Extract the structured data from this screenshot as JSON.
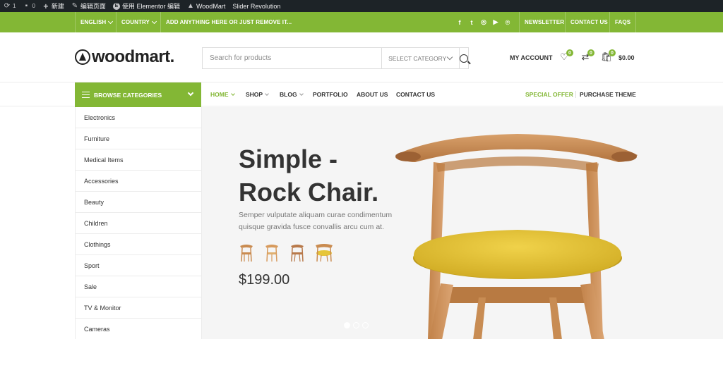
{
  "admin_bar": {
    "updates_count": "1",
    "comments_count": "0",
    "new_label": "新建",
    "edit_page_label": "编辑页面",
    "elementor_label": "使用 Elementor 编辑",
    "woodmart_label": "WoodMart",
    "slider_label": "Slider Revolution"
  },
  "topbar": {
    "language": "ENGLISH",
    "country": "COUNTRY",
    "promo": "ADD ANYTHING HERE OR JUST REMOVE IT...",
    "social_icons": [
      "facebook-icon",
      "twitter-icon",
      "instagram-icon",
      "youtube-icon",
      "pinterest-icon"
    ],
    "links": [
      "NEWSLETTER",
      "CONTACT US",
      "FAQS"
    ]
  },
  "header": {
    "logo_text": "woodmart.",
    "search_placeholder": "Search for products",
    "category_select": "SELECT CATEGORY",
    "account_label": "MY ACCOUNT",
    "wishlist_count": "0",
    "compare_count": "0",
    "cart_count": "0",
    "cart_total": "$0.00"
  },
  "nav": {
    "browse_label": "BROWSE CATEGORIES",
    "items": [
      {
        "label": "HOME",
        "active": true,
        "dropdown": true
      },
      {
        "label": "SHOP",
        "dropdown": true
      },
      {
        "label": "BLOG",
        "dropdown": true
      },
      {
        "label": "PORTFOLIO"
      },
      {
        "label": "ABOUT US"
      },
      {
        "label": "CONTACT US"
      }
    ],
    "special_offer": "SPECIAL OFFER",
    "purchase_theme": "PURCHASE THEME"
  },
  "categories": [
    "Electronics",
    "Furniture",
    "Medical Items",
    "Accessories",
    "Beauty",
    "Children",
    "Clothings",
    "Sport",
    "Sale",
    "TV & Monitor",
    "Cameras"
  ],
  "slide": {
    "title_line1": "Simple -",
    "title_line2": "Rock Chair.",
    "desc_line1": "Semper vulputate aliquam curae condimentum",
    "desc_line2": "quisque gravida fusce convallis arcu cum at.",
    "price": "$199.00",
    "active_dot": 1,
    "dot_count": 3
  },
  "colors": {
    "accent": "#83b735",
    "admin_bar": "#1d2327",
    "seat": "#e6c53a",
    "wood": "#c98b50"
  }
}
